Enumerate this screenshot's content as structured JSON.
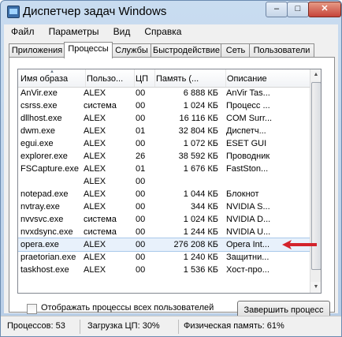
{
  "window": {
    "title": "Диспетчер задач Windows",
    "minimize": "–",
    "maximize": "□",
    "close": "✕"
  },
  "menu": [
    "Файл",
    "Параметры",
    "Вид",
    "Справка"
  ],
  "tabs": [
    "Приложения",
    "Процессы",
    "Службы",
    "Быстродействие",
    "Сеть",
    "Пользователи"
  ],
  "active_tab": "Процессы",
  "columns": {
    "name": "Имя образа",
    "user": "Пользо...",
    "cpu": "ЦП",
    "memory": "Память (...",
    "description": "Описание"
  },
  "processes": [
    {
      "name": "AnVir.exe",
      "user": "ALEX",
      "cpu": "00",
      "memory": "6 888 КБ",
      "description": "AnVir Tas..."
    },
    {
      "name": "csrss.exe",
      "user": "система",
      "cpu": "00",
      "memory": "1 024 КБ",
      "description": "Процесс ..."
    },
    {
      "name": "dllhost.exe",
      "user": "ALEX",
      "cpu": "00",
      "memory": "16 116 КБ",
      "description": "COM Surr..."
    },
    {
      "name": "dwm.exe",
      "user": "ALEX",
      "cpu": "01",
      "memory": "32 804 КБ",
      "description": "Диспетч..."
    },
    {
      "name": "egui.exe",
      "user": "ALEX",
      "cpu": "00",
      "memory": "1 072 КБ",
      "description": "ESET GUI"
    },
    {
      "name": "explorer.exe",
      "user": "ALEX",
      "cpu": "26",
      "memory": "38 592 КБ",
      "description": "Проводник"
    },
    {
      "name": "FSCapture.exe",
      "user": "ALEX",
      "cpu": "01",
      "memory": "1 676 КБ",
      "description": "FastSton..."
    },
    {
      "name": "",
      "user": "ALEX",
      "cpu": "00",
      "memory": "",
      "description": ""
    },
    {
      "name": "notepad.exe",
      "user": "ALEX",
      "cpu": "00",
      "memory": "1 044 КБ",
      "description": "Блокнот"
    },
    {
      "name": "nvtray.exe",
      "user": "ALEX",
      "cpu": "00",
      "memory": "344 КБ",
      "description": "NVIDIA S..."
    },
    {
      "name": "nvvsvc.exe",
      "user": "система",
      "cpu": "00",
      "memory": "1 024 КБ",
      "description": "NVIDIA D..."
    },
    {
      "name": "nvxdsync.exe",
      "user": "система",
      "cpu": "00",
      "memory": "1 244 КБ",
      "description": "NVIDIA U..."
    },
    {
      "name": "opera.exe",
      "user": "ALEX",
      "cpu": "00",
      "memory": "276 208 КБ",
      "description": "Opera Int...",
      "selected": true
    },
    {
      "name": "praetorian.exe",
      "user": "ALEX",
      "cpu": "00",
      "memory": "1 240 КБ",
      "description": "Защитни..."
    },
    {
      "name": "taskhost.exe",
      "user": "ALEX",
      "cpu": "00",
      "memory": "1 536 КБ",
      "description": "Хост-про..."
    }
  ],
  "show_all_label": "Отображать процессы всех пользователей",
  "end_process_label": "Завершить процесс",
  "status": {
    "processes": "Процессов: 53",
    "cpu": "Загрузка ЦП: 30%",
    "memory": "Физическая память: 61%"
  },
  "colors": {
    "arrow": "#d3232b",
    "selection": "#e8f1fb",
    "title_bg": "#c9dcf0"
  }
}
